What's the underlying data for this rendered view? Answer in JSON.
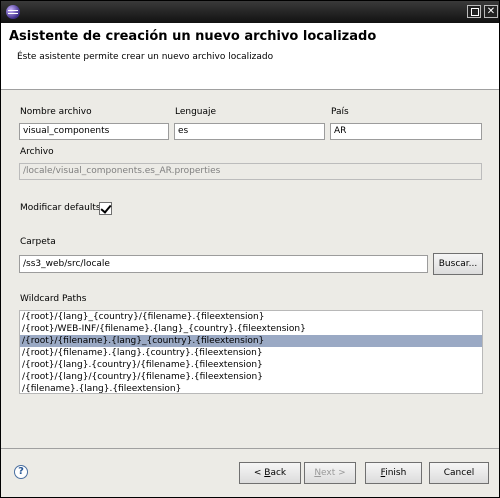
{
  "header": {
    "title": "Asistente de creación un nuevo archivo localizado",
    "description": "Éste asistente permite crear un nuevo archivo localizado"
  },
  "form": {
    "nombre_label": "Nombre archivo",
    "nombre_value": "visual_components",
    "lenguaje_label": "Lenguaje",
    "lenguaje_value": "es",
    "pais_label": "País",
    "pais_value": "AR",
    "archivo_label": "Archivo",
    "archivo_value": "/locale/visual_components.es_AR.properties",
    "defaults_label": "Modificar defaults",
    "defaults_checked": true,
    "carpeta_label": "Carpeta",
    "carpeta_value": "/ss3_web/src/locale",
    "buscar_label": "Buscar...",
    "wildcard_label": "Wildcard Paths"
  },
  "wildcard_paths": [
    "/{root}/{lang}_{country}/{filename}.{fileextension}",
    "/{root}/WEB-INF/{filename}.{lang}_{country}.{fileextension}",
    "/{root}/{filename}.{lang}_{country}.{fileextension}",
    "/{root}/{filename}.{lang}.{country}.{fileextension}",
    "/{root}/{lang}.{country}/{filename}.{fileextension}",
    "/{root}/{lang}/{country}/{filename}.{fileextension}",
    "/{filename}.{lang}.{fileextension}"
  ],
  "selected_path_index": 2,
  "footer": {
    "back_prefix": "< ",
    "back_mnemonic": "B",
    "back_rest": "ack",
    "next_mnemonic": "N",
    "next_rest": "ext >",
    "finish_mnemonic": "F",
    "finish_rest": "inish",
    "cancel_label": "Cancel",
    "help_glyph": "?"
  },
  "colors": {
    "selection": "#9aa9c4",
    "dialog_bg": "#ecebe6",
    "titlebar": "#111111"
  }
}
